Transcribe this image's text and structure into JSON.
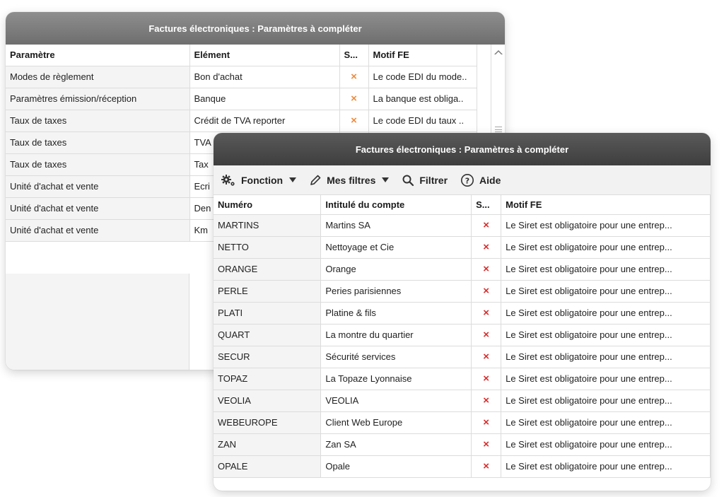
{
  "back_window": {
    "title": "Factures électroniques : Paramètres à compléter",
    "columns": [
      "Paramètre",
      "Elément",
      "S...",
      "Motif FE"
    ],
    "rows": [
      {
        "param": "Modes de règlement",
        "element": "Bon d'achat",
        "status": "×",
        "motif": "Le code EDI du mode.."
      },
      {
        "param": "Paramètres émission/réception",
        "element": "Banque",
        "status": "×",
        "motif": "La banque est obliga.."
      },
      {
        "param": "Taux de taxes",
        "element": "Crédit de TVA reporter",
        "status": "×",
        "motif": "Le code EDI du taux .."
      },
      {
        "param": "Taux de taxes",
        "element": "TVA",
        "status": "",
        "motif": ""
      },
      {
        "param": "Taux de taxes",
        "element": "Tax",
        "status": "",
        "motif": ""
      },
      {
        "param": "Unité d'achat et vente",
        "element": "Ecri",
        "status": "",
        "motif": ""
      },
      {
        "param": "Unité d'achat et vente",
        "element": "Den",
        "status": "",
        "motif": ""
      },
      {
        "param": "Unité d'achat et vente",
        "element": "Km",
        "status": "",
        "motif": ""
      }
    ]
  },
  "front_window": {
    "title": "Factures électroniques : Paramètres à compléter",
    "toolbar": {
      "fonction": "Fonction",
      "filtres": "Mes filtres",
      "filtrer": "Filtrer",
      "aide": "Aide"
    },
    "columns": [
      "Numéro",
      "Intitulé du compte",
      "S...",
      "Motif FE"
    ],
    "rows": [
      {
        "num": "MARTINS",
        "intitule": "Martins SA",
        "status": "×",
        "motif": "Le Siret est obligatoire pour une entrep..."
      },
      {
        "num": "NETTO",
        "intitule": "Nettoyage et Cie",
        "status": "×",
        "motif": "Le Siret est obligatoire pour une entrep..."
      },
      {
        "num": "ORANGE",
        "intitule": "Orange",
        "status": "×",
        "motif": "Le Siret est obligatoire pour une entrep..."
      },
      {
        "num": "PERLE",
        "intitule": "Peries parisiennes",
        "status": "×",
        "motif": "Le Siret est obligatoire pour une entrep..."
      },
      {
        "num": "PLATI",
        "intitule": "Platine & fils",
        "status": "×",
        "motif": "Le Siret est obligatoire pour une entrep..."
      },
      {
        "num": "QUART",
        "intitule": "La montre du quartier",
        "status": "×",
        "motif": "Le Siret est obligatoire pour une entrep..."
      },
      {
        "num": "SECUR",
        "intitule": "Sécurité services",
        "status": "×",
        "motif": "Le Siret est obligatoire pour une entrep..."
      },
      {
        "num": "TOPAZ",
        "intitule": "La Topaze Lyonnaise",
        "status": "×",
        "motif": "Le Siret est obligatoire pour une entrep..."
      },
      {
        "num": "VEOLIA",
        "intitule": "VEOLIA",
        "status": "×",
        "motif": "Le Siret est obligatoire pour une entrep..."
      },
      {
        "num": "WEBEUROPE",
        "intitule": "Client Web Europe",
        "status": "×",
        "motif": "Le Siret est obligatoire pour une entrep..."
      },
      {
        "num": "ZAN",
        "intitule": "Zan SA",
        "status": "×",
        "motif": "Le Siret est obligatoire pour une entrep..."
      },
      {
        "num": "OPALE",
        "intitule": "Opale",
        "status": "×",
        "motif": "Le Siret est obligatoire pour une entrep..."
      }
    ]
  },
  "colors": {
    "status_orange": "#f08a3c",
    "status_red": "#d92d2d",
    "back_title_bg": "#7e7e7e",
    "front_title_bg": "#4a4a4a"
  }
}
